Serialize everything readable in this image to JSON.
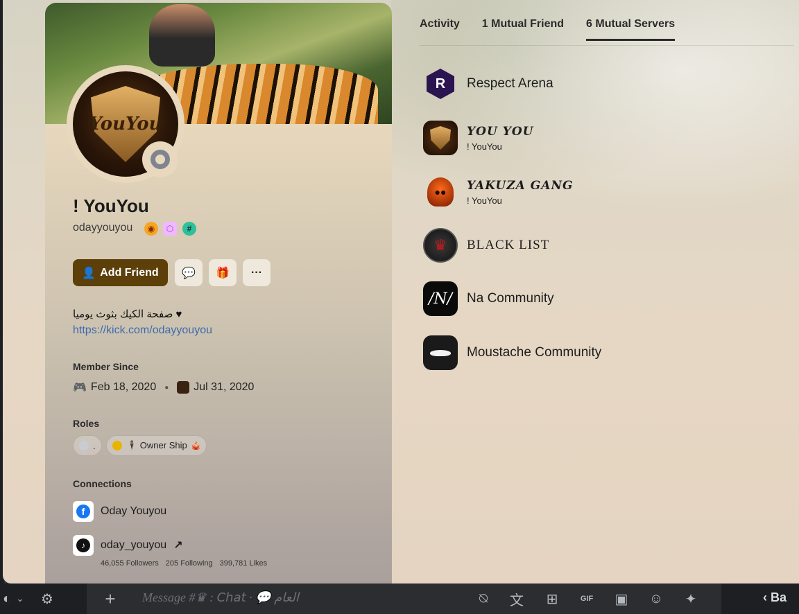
{
  "profile": {
    "display_name": "! YouYou",
    "username": "odayyouyou",
    "avatar_text": "YouYou",
    "add_friend_label": "Add Friend",
    "bio_text": "صفحة الكيك بثوث يوميا ♥",
    "bio_link": "https://kick.com/odayyouyou",
    "member_since_title": "Member Since",
    "discord_since": "Feb 18, 2020",
    "server_since": "Jul 31, 2020",
    "roles_title": "Roles",
    "roles": [
      {
        "label": ".",
        "color": "#c9cdd3"
      },
      {
        "label": "🕴 Owner Ship",
        "color": "#e8b400",
        "emoji": "🎪"
      }
    ],
    "connections_title": "Connections",
    "connections": [
      {
        "label": "Oday Youyou",
        "icon": "facebook-icon"
      },
      {
        "label": "oday_youyou",
        "icon": "tiktok-icon",
        "external": "↗"
      }
    ],
    "tiktok_stats": {
      "followers": "46,055 Followers",
      "following": "205 Following",
      "likes": "399,781 Likes"
    }
  },
  "tabs": [
    {
      "label": "Activity",
      "active": false
    },
    {
      "label": "1 Mutual Friend",
      "active": false
    },
    {
      "label": "6 Mutual Servers",
      "active": true
    }
  ],
  "servers": [
    {
      "name": "Respect Arena",
      "nickname": ""
    },
    {
      "name": "YOU YOU",
      "nickname": "! YouYou"
    },
    {
      "name": "YAKUZA GANG",
      "nickname": "! YouYou"
    },
    {
      "name": "BLACK LIST",
      "nickname": ""
    },
    {
      "name": "Na Community",
      "nickname": ""
    },
    {
      "name": "Moustache Community",
      "nickname": ""
    }
  ],
  "chat": {
    "placeholder": "Message #♛ : 𝘊𝘩𝘢𝘵 · 💬 العام",
    "back_label": "Ba"
  },
  "colors": {
    "accent_button": "#5c3f09",
    "link": "#3d6ab0",
    "status_offline": "#80848e"
  }
}
